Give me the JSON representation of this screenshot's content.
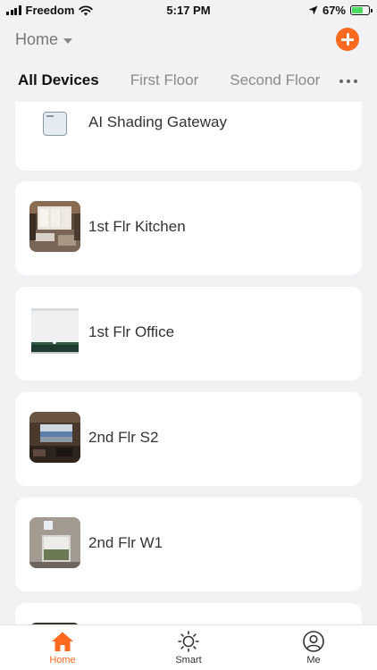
{
  "status_bar": {
    "carrier": "Freedom",
    "time": "5:17 PM",
    "battery_percent": "67%",
    "battery_level": 0.67
  },
  "header": {
    "home_title": "Home"
  },
  "tabs": [
    {
      "label": "All Devices",
      "active": true
    },
    {
      "label": "First Floor",
      "active": false
    },
    {
      "label": "Second Floor",
      "active": false
    }
  ],
  "devices": [
    {
      "name": "AI Shading Gateway",
      "icon": "gateway-icon"
    },
    {
      "name": "1st Flr Kitchen",
      "icon": "kitchen-photo"
    },
    {
      "name": "1st Flr Office",
      "icon": "shade-photo"
    },
    {
      "name": "2nd Flr S2",
      "icon": "window-photo"
    },
    {
      "name": "2nd Flr W1",
      "icon": "window-photo"
    }
  ],
  "bottom_nav": [
    {
      "label": "Home",
      "icon": "home-icon",
      "active": true
    },
    {
      "label": "Smart",
      "icon": "sun-icon",
      "active": false
    },
    {
      "label": "Me",
      "icon": "profile-icon",
      "active": false
    }
  ],
  "colors": {
    "accent": "#ff6a1f",
    "background": "#f2f2f4",
    "card": "#ffffff",
    "battery_fill": "#4cd964"
  }
}
